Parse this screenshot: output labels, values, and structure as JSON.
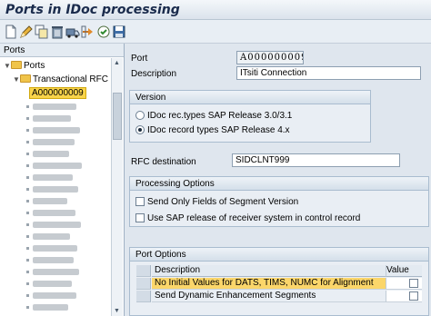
{
  "window": {
    "title": "Ports in IDoc processing"
  },
  "toolbar": {
    "icons": [
      "new-document-icon",
      "edit-pencil-icon",
      "copy-icon",
      "delete-trash-icon",
      "transport-truck-icon",
      "where-used-icon",
      "activate-icon",
      "save-layout-icon"
    ]
  },
  "left_panel": {
    "header": "Ports",
    "tree": {
      "root": "Ports",
      "child": "Transactional RFC",
      "selected_item": "A000000009"
    }
  },
  "form": {
    "port_label": "Port",
    "port_value": "A000000009",
    "description_label": "Description",
    "description_value": "ITsiti Connection",
    "version": {
      "title": "Version",
      "options": [
        {
          "label": "IDoc rec.types SAP Release 3.0/3.1",
          "selected": false
        },
        {
          "label": "IDoc record types SAP Release 4.x",
          "selected": true
        }
      ]
    },
    "rfc_label": "RFC destination",
    "rfc_value": "SIDCLNT999",
    "processing": {
      "title": "Processing Options",
      "options": [
        {
          "label": "Send Only Fields of Segment Version",
          "checked": false
        },
        {
          "label": "Use SAP release of receiver system in control record",
          "checked": false
        }
      ]
    },
    "port_options": {
      "title": "Port Options",
      "columns": [
        "Description",
        "Value"
      ],
      "rows": [
        {
          "description": "No Initial Values for DATS, TIMS, NUMC for Alignment",
          "checked": false,
          "highlighted": true
        },
        {
          "description": "Send Dynamic Enhancement Segments",
          "checked": false,
          "highlighted": false
        }
      ]
    }
  },
  "colors": {
    "selection": "#f9d44a",
    "row_highlight": "#fbd66a",
    "title_text": "#1a2b4c"
  }
}
